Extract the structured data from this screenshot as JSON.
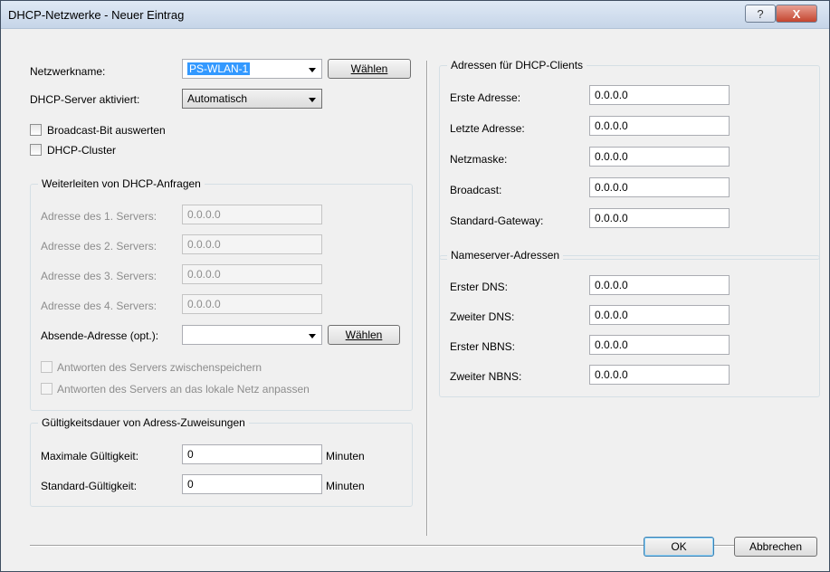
{
  "window": {
    "title": "DHCP-Netzwerke - Neuer Eintrag",
    "help_label": "?",
    "close_label": "X"
  },
  "left": {
    "network_name": {
      "label": "Netzwerkname:",
      "value": "PS-WLAN-1",
      "button": "Wählen"
    },
    "dhcp_server": {
      "label": "DHCP-Server aktiviert:",
      "value": "Automatisch"
    },
    "broadcast_bit": {
      "label": "Broadcast-Bit auswerten",
      "checked": false
    },
    "dhcp_cluster": {
      "label": "DHCP-Cluster",
      "checked": false
    }
  },
  "forward": {
    "title": "Weiterleiten von DHCP-Anfragen",
    "servers": [
      {
        "label": "Adresse des 1. Servers:",
        "value": "0.0.0.0"
      },
      {
        "label": "Adresse des 2. Servers:",
        "value": "0.0.0.0"
      },
      {
        "label": "Adresse des 3. Servers:",
        "value": "0.0.0.0"
      },
      {
        "label": "Adresse des 4. Servers:",
        "value": "0.0.0.0"
      }
    ],
    "sender": {
      "label": "Absende-Adresse (opt.):",
      "value": "",
      "button": "Wählen"
    },
    "cache_label": "Antworten des Servers zwischenspeichern",
    "adapt_label": "Antworten des Servers an das lokale Netz anpassen"
  },
  "validity": {
    "title": "Gültigkeitsdauer von Adress-Zuweisungen",
    "max": {
      "label": "Maximale Gültigkeit:",
      "value": "0",
      "unit": "Minuten"
    },
    "std": {
      "label": "Standard-Gültigkeit:",
      "value": "0",
      "unit": "Minuten"
    }
  },
  "clients": {
    "title": "Adressen für DHCP-Clients",
    "fields": [
      {
        "label": "Erste Adresse:",
        "value": "0.0.0.0"
      },
      {
        "label": "Letzte Adresse:",
        "value": "0.0.0.0"
      },
      {
        "label": "Netzmaske:",
        "value": "0.0.0.0"
      },
      {
        "label": "Broadcast:",
        "value": "0.0.0.0"
      },
      {
        "label": "Standard-Gateway:",
        "value": "0.0.0.0"
      }
    ]
  },
  "nameservers": {
    "title": "Nameserver-Adressen",
    "fields": [
      {
        "label": "Erster DNS:",
        "value": "0.0.0.0"
      },
      {
        "label": "Zweiter DNS:",
        "value": "0.0.0.0"
      },
      {
        "label": "Erster NBNS:",
        "value": "0.0.0.0"
      },
      {
        "label": "Zweiter NBNS:",
        "value": "0.0.0.0"
      }
    ]
  },
  "footer": {
    "ok": "OK",
    "cancel": "Abbrechen"
  }
}
